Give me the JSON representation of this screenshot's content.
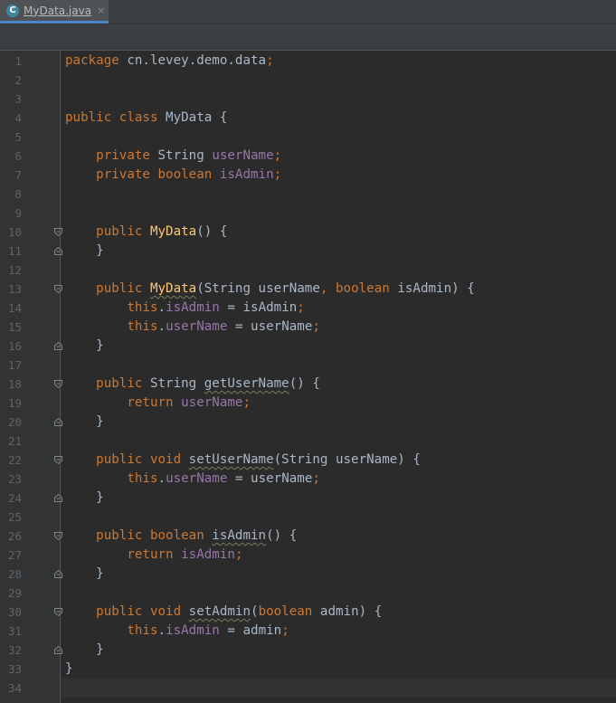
{
  "tab": {
    "icon_letter": "C",
    "label": "MyData.java",
    "close": "×"
  },
  "line_numbers": [
    "1",
    "2",
    "3",
    "4",
    "5",
    "6",
    "7",
    "8",
    "9",
    "10",
    "11",
    "12",
    "13",
    "14",
    "15",
    "16",
    "17",
    "18",
    "19",
    "20",
    "21",
    "22",
    "23",
    "24",
    "25",
    "26",
    "27",
    "28",
    "29",
    "30",
    "31",
    "32",
    "33",
    "34"
  ],
  "fold_lines": [
    10,
    11,
    13,
    16,
    18,
    20,
    22,
    24,
    26,
    28,
    30,
    32
  ],
  "fold_open_lines": [
    10,
    13,
    18,
    22,
    26,
    30
  ],
  "current_line": 34,
  "code": [
    [
      [
        "kw",
        "package "
      ],
      [
        "",
        "cn.levey.demo.data"
      ],
      [
        "punc",
        ";"
      ]
    ],
    [],
    [],
    [
      [
        "kw",
        "public class "
      ],
      [
        "",
        "MyData {"
      ]
    ],
    [],
    [
      [
        "",
        "    "
      ],
      [
        "kw",
        "private "
      ],
      [
        "",
        "String "
      ],
      [
        "fld",
        "userName"
      ],
      [
        "punc",
        ";"
      ]
    ],
    [
      [
        "",
        "    "
      ],
      [
        "kw",
        "private boolean "
      ],
      [
        "fld",
        "isAdmin"
      ],
      [
        "punc",
        ";"
      ]
    ],
    [],
    [],
    [
      [
        "",
        "    "
      ],
      [
        "kw",
        "public "
      ],
      [
        "fn",
        "MyData"
      ],
      [
        "",
        "() {"
      ]
    ],
    [
      [
        "",
        "    }"
      ]
    ],
    [],
    [
      [
        "",
        "    "
      ],
      [
        "kw",
        "public "
      ],
      [
        "fn warn",
        "MyData"
      ],
      [
        "",
        "(String userName"
      ],
      [
        "punc",
        ", "
      ],
      [
        "kw",
        "boolean "
      ],
      [
        "",
        "isAdmin) {"
      ]
    ],
    [
      [
        "",
        "        "
      ],
      [
        "kw",
        "this"
      ],
      [
        "",
        "."
      ],
      [
        "fld",
        "isAdmin"
      ],
      [
        "",
        " = isAdmin"
      ],
      [
        "punc",
        ";"
      ]
    ],
    [
      [
        "",
        "        "
      ],
      [
        "kw",
        "this"
      ],
      [
        "",
        "."
      ],
      [
        "fld",
        "userName"
      ],
      [
        "",
        " = userName"
      ],
      [
        "punc",
        ";"
      ]
    ],
    [
      [
        "",
        "    }"
      ]
    ],
    [],
    [
      [
        "",
        "    "
      ],
      [
        "kw",
        "public "
      ],
      [
        "",
        "String "
      ],
      [
        "warn",
        "getUserName"
      ],
      [
        "",
        "() {"
      ]
    ],
    [
      [
        "",
        "        "
      ],
      [
        "kw",
        "return "
      ],
      [
        "fld",
        "userName"
      ],
      [
        "punc",
        ";"
      ]
    ],
    [
      [
        "",
        "    }"
      ]
    ],
    [],
    [
      [
        "",
        "    "
      ],
      [
        "kw",
        "public void "
      ],
      [
        "warn",
        "setUserName"
      ],
      [
        "",
        "(String userName) {"
      ]
    ],
    [
      [
        "",
        "        "
      ],
      [
        "kw",
        "this"
      ],
      [
        "",
        "."
      ],
      [
        "fld",
        "userName"
      ],
      [
        "",
        " = userName"
      ],
      [
        "punc",
        ";"
      ]
    ],
    [
      [
        "",
        "    }"
      ]
    ],
    [],
    [
      [
        "",
        "    "
      ],
      [
        "kw",
        "public boolean "
      ],
      [
        "warn",
        "isAdmin"
      ],
      [
        "",
        "() {"
      ]
    ],
    [
      [
        "",
        "        "
      ],
      [
        "kw",
        "return "
      ],
      [
        "fld",
        "isAdmin"
      ],
      [
        "punc",
        ";"
      ]
    ],
    [
      [
        "",
        "    }"
      ]
    ],
    [],
    [
      [
        "",
        "    "
      ],
      [
        "kw",
        "public void "
      ],
      [
        "warn",
        "setAdmin"
      ],
      [
        "",
        "("
      ],
      [
        "kw",
        "boolean "
      ],
      [
        "",
        "admin) {"
      ]
    ],
    [
      [
        "",
        "        "
      ],
      [
        "kw",
        "this"
      ],
      [
        "",
        "."
      ],
      [
        "fld",
        "isAdmin"
      ],
      [
        "",
        " = admin"
      ],
      [
        "punc",
        ";"
      ]
    ],
    [
      [
        "",
        "    }"
      ]
    ],
    [
      [
        "",
        "}"
      ]
    ],
    []
  ]
}
